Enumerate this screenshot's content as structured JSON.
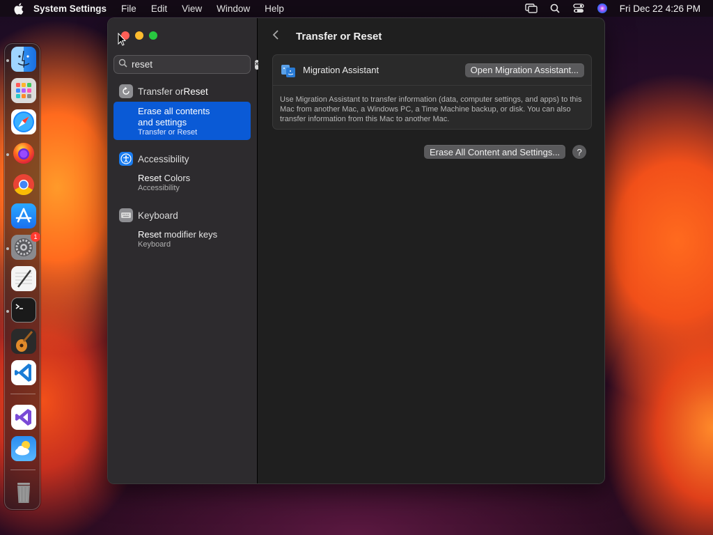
{
  "menubar": {
    "app_name": "System Settings",
    "menus": [
      "File",
      "Edit",
      "View",
      "Window",
      "Help"
    ],
    "clock": "Fri Dec 22  4:26 PM"
  },
  "dock": {
    "items": [
      {
        "name": "Finder",
        "icon": "finder-icon",
        "running": true
      },
      {
        "name": "Launchpad",
        "icon": "launchpad-icon",
        "running": false
      },
      {
        "name": "Safari",
        "icon": "safari-icon",
        "running": false
      },
      {
        "name": "Firefox",
        "icon": "firefox-icon",
        "running": true
      },
      {
        "name": "Chrome",
        "icon": "chrome-icon",
        "running": false
      },
      {
        "name": "App Store",
        "icon": "app-store-icon",
        "running": false
      },
      {
        "name": "System Settings",
        "icon": "system-settings-icon",
        "running": true,
        "badge": "1"
      },
      {
        "name": "TextEdit",
        "icon": "textedit-icon",
        "running": false
      },
      {
        "name": "Terminal",
        "icon": "terminal-icon",
        "running": true
      },
      {
        "name": "GarageBand",
        "icon": "garageband-icon",
        "running": false
      },
      {
        "name": "Visual Studio Code",
        "icon": "vscode-icon",
        "running": false
      },
      {
        "name": "Visual Studio",
        "icon": "visual-studio-icon",
        "running": false
      },
      {
        "name": "Weather",
        "icon": "weather-icon",
        "running": false
      },
      {
        "name": "Trash",
        "icon": "trash-icon",
        "running": false
      }
    ]
  },
  "sidebar": {
    "search": {
      "value": "reset",
      "placeholder": "Search"
    },
    "groups": [
      {
        "title_pre": "Transfer or ",
        "title_bold": "Reset",
        "icon": "transfer-reset-icon",
        "result": {
          "line1": "Erase all contents",
          "line2": "and settings",
          "sub": "Transfer or Reset",
          "selected": true
        }
      },
      {
        "title_pre": "Accessibility",
        "title_bold": "",
        "icon": "accessibility-icon",
        "result": {
          "bold": "Reset",
          "rest": " Colors",
          "sub": "Accessibility",
          "selected": false
        }
      },
      {
        "title_pre": "Keyboard",
        "title_bold": "",
        "icon": "keyboard-icon",
        "result": {
          "bold": "Reset",
          "rest": " modifier keys",
          "sub": "Keyboard",
          "selected": false
        }
      }
    ]
  },
  "content": {
    "title": "Transfer or Reset",
    "migration": {
      "title": "Migration Assistant",
      "button": "Open Migration Assistant...",
      "description": "Use Migration Assistant to transfer information (data, computer settings, and apps) to this Mac from another Mac, a Windows PC, a Time Machine backup, or disk. You can also transfer information from this Mac to another Mac."
    },
    "erase_button": "Erase All Content and Settings...",
    "help": "?"
  },
  "colors": {
    "accent": "#0a5ad6",
    "close": "#ff5f57",
    "minimize": "#febc2e",
    "zoom": "#28c840"
  }
}
